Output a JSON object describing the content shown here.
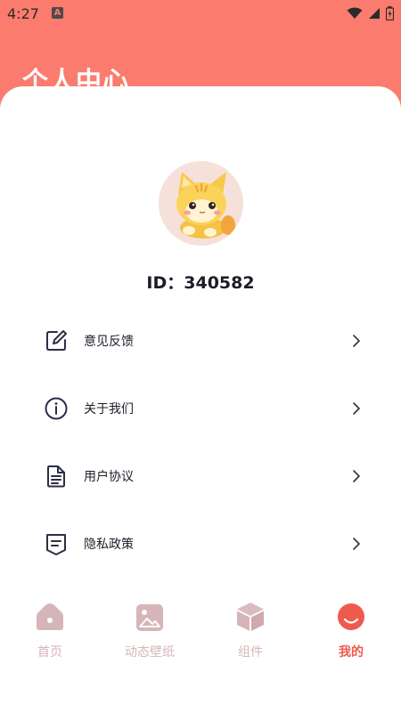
{
  "status_bar": {
    "time": "4:27",
    "notification_icon": "A"
  },
  "header": {
    "title": "个人中心"
  },
  "profile": {
    "id_text": "ID：340582",
    "avatar": "kitten-avatar"
  },
  "menu": [
    {
      "label": "意见反馈",
      "icon": "edit-icon"
    },
    {
      "label": "关于我们",
      "icon": "info-icon"
    },
    {
      "label": "用户协议",
      "icon": "document-icon"
    },
    {
      "label": "隐私政策",
      "icon": "privacy-icon"
    }
  ],
  "tabbar": [
    {
      "label": "首页",
      "icon": "home-icon",
      "active": false
    },
    {
      "label": "动态壁纸",
      "icon": "wallpaper-icon",
      "active": false
    },
    {
      "label": "组件",
      "icon": "widget-icon",
      "active": false
    },
    {
      "label": "我的",
      "icon": "profile-icon",
      "active": true
    }
  ],
  "colors": {
    "accent": "#fb7b6e",
    "active_tab": "#f05a4e",
    "inactive_tab": "#d6b5b8"
  }
}
